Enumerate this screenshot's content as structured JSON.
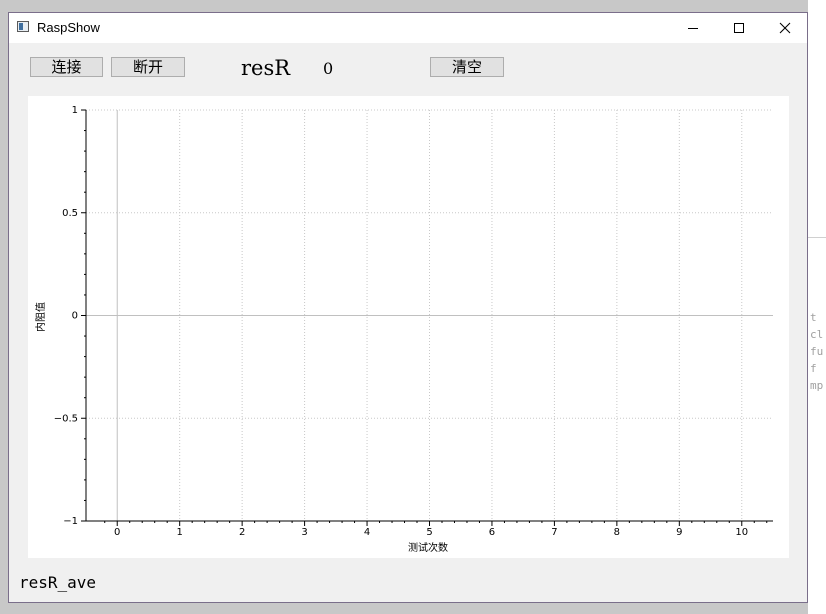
{
  "background": {
    "code_lines": [
      "t",
      "cl",
      "fu",
      "f",
      "mp"
    ]
  },
  "window": {
    "title": "RaspShow"
  },
  "toolbar": {
    "connect_label": "连接",
    "disconnect_label": "断开",
    "clear_label": "清空",
    "res_label": "resR",
    "res_value": "0"
  },
  "footer": {
    "ave_label": "resR_ave"
  },
  "chart_data": {
    "type": "line",
    "xlabel": "测试次数",
    "ylabel": "内阻值",
    "xlim": [
      -0.5,
      10.5
    ],
    "ylim": [
      -1,
      1
    ],
    "x_ticks": [
      0,
      1,
      2,
      3,
      4,
      5,
      6,
      7,
      8,
      9,
      10
    ],
    "y_ticks": [
      -1,
      -0.5,
      0,
      0.5,
      1
    ],
    "y_tick_labels": [
      "−1",
      "−0.5",
      "0",
      "0.5",
      "1"
    ],
    "grid": true,
    "series": []
  }
}
